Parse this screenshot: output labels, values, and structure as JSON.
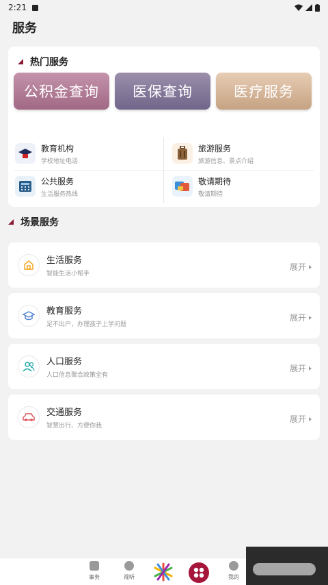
{
  "status": {
    "time": "2:21"
  },
  "header": {
    "title": "服务"
  },
  "hot": {
    "title": "热门服务",
    "banners": [
      "公积金查询",
      "医保查询",
      "医疗服务"
    ],
    "services": [
      {
        "title": "教育机构",
        "subtitle": "学校地址电话",
        "icon": "graduation-cap-icon"
      },
      {
        "title": "旅游服务",
        "subtitle": "旅游信息、景点介绍",
        "icon": "luggage-icon"
      },
      {
        "title": "公共服务",
        "subtitle": "生活服务热线",
        "icon": "telephone-icon"
      },
      {
        "title": "敬请期待",
        "subtitle": "敬请期待",
        "icon": "cards-icon"
      }
    ]
  },
  "scene": {
    "title": "场景服务",
    "expand_label": "展开",
    "items": [
      {
        "title": "生活服务",
        "subtitle": "智能生活小帮手",
        "icon": "home-icon",
        "color": "#f5a623"
      },
      {
        "title": "教育服务",
        "subtitle": "足不出户，办理孩子上学问题",
        "icon": "mortarboard-icon",
        "color": "#4a7fd4"
      },
      {
        "title": "人口服务",
        "subtitle": "人口信息聚合政策全有",
        "icon": "people-icon",
        "color": "#1fa8a8"
      },
      {
        "title": "交通服务",
        "subtitle": "智慧出行、方便你我",
        "icon": "car-icon",
        "color": "#e0545c"
      }
    ]
  },
  "tabs": [
    {
      "label": "事务",
      "icon": "document-icon"
    },
    {
      "label": "视听",
      "icon": "disc-icon"
    },
    {
      "label": "",
      "icon": "logo-star-icon"
    },
    {
      "label": "",
      "icon": "grid-circle-icon"
    },
    {
      "label": "我的",
      "icon": "user-icon"
    }
  ],
  "colors": {
    "accent": "#8b1a33"
  }
}
